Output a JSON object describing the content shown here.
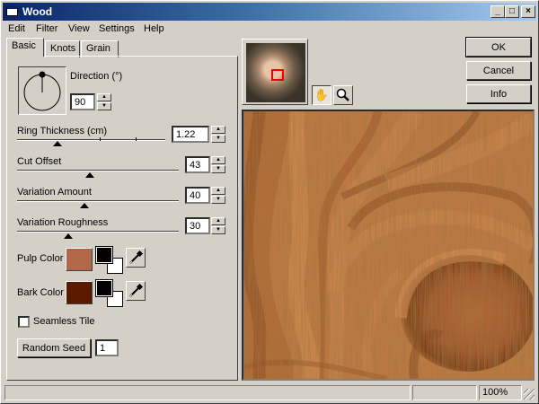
{
  "window": {
    "title": "Wood",
    "minimize": "_",
    "maximize": "□",
    "close": "×"
  },
  "menu": {
    "items": [
      "Edit",
      "Filter",
      "View",
      "Settings",
      "Help"
    ]
  },
  "tabs": [
    {
      "label": "Basic",
      "active": true
    },
    {
      "label": "Knots",
      "active": false
    },
    {
      "label": "Grain",
      "active": false
    }
  ],
  "basic": {
    "direction_label": "Direction (°)",
    "direction_value": "90",
    "ring_thickness_label": "Ring Thickness (cm)",
    "ring_thickness_value": "1.22",
    "cut_offset_label": "Cut Offset",
    "cut_offset_value": "43",
    "variation_amount_label": "Variation Amount",
    "variation_amount_value": "40",
    "variation_roughness_label": "Variation Roughness",
    "variation_roughness_value": "30",
    "pulp_color_label": "Pulp Color",
    "pulp_color": "#b1674a",
    "bark_color_label": "Bark Color",
    "bark_color": "#5a1a00",
    "seamless_tile_label": "Seamless Tile",
    "seamless_tile_checked": false,
    "random_seed_label": "Random Seed",
    "random_seed_value": "1"
  },
  "buttons": {
    "ok": "OK",
    "cancel": "Cancel",
    "info": "Info"
  },
  "tools": {
    "hand_icon": "hand-icon",
    "zoom_icon": "magnifier-icon"
  },
  "status": {
    "zoom": "100%"
  }
}
